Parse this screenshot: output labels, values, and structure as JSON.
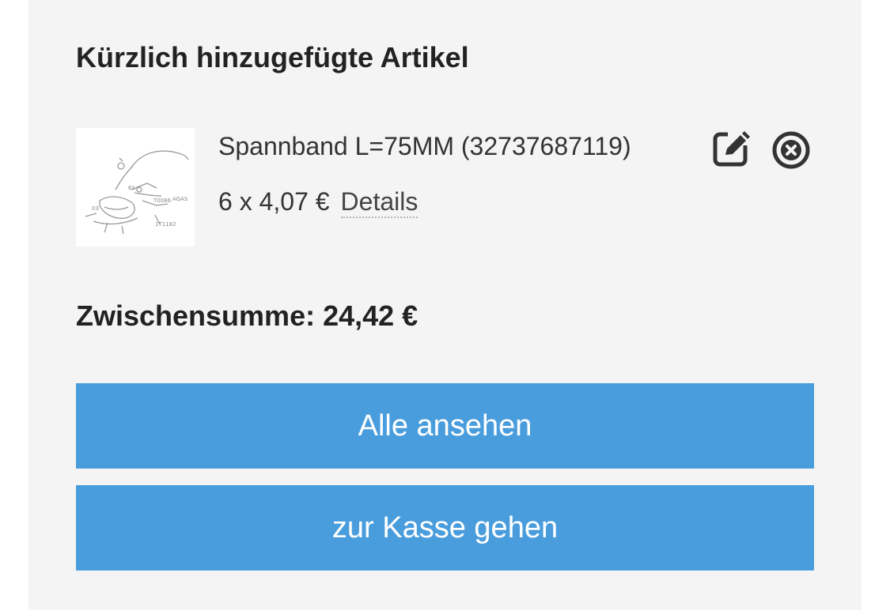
{
  "minicart": {
    "title": "Kürzlich hinzugefügte Artikel",
    "items": [
      {
        "name": "Spannband L=75MM (32737687119)",
        "quantity_price": "6 x 4,07 €",
        "details_label": "Details",
        "thumbnail_icon": "part-diagram-thumbnail",
        "edit_icon": "edit-icon",
        "remove_icon": "remove-circle-icon"
      }
    ],
    "subtotal": "Zwischensumme: 24,42 €",
    "view_all_label": "Alle ansehen",
    "checkout_label": "zur Kasse gehen"
  },
  "colors": {
    "panel_bg": "#f4f4f4",
    "button_bg": "#4a9ddd",
    "button_text": "#ffffff",
    "text": "#333333"
  }
}
